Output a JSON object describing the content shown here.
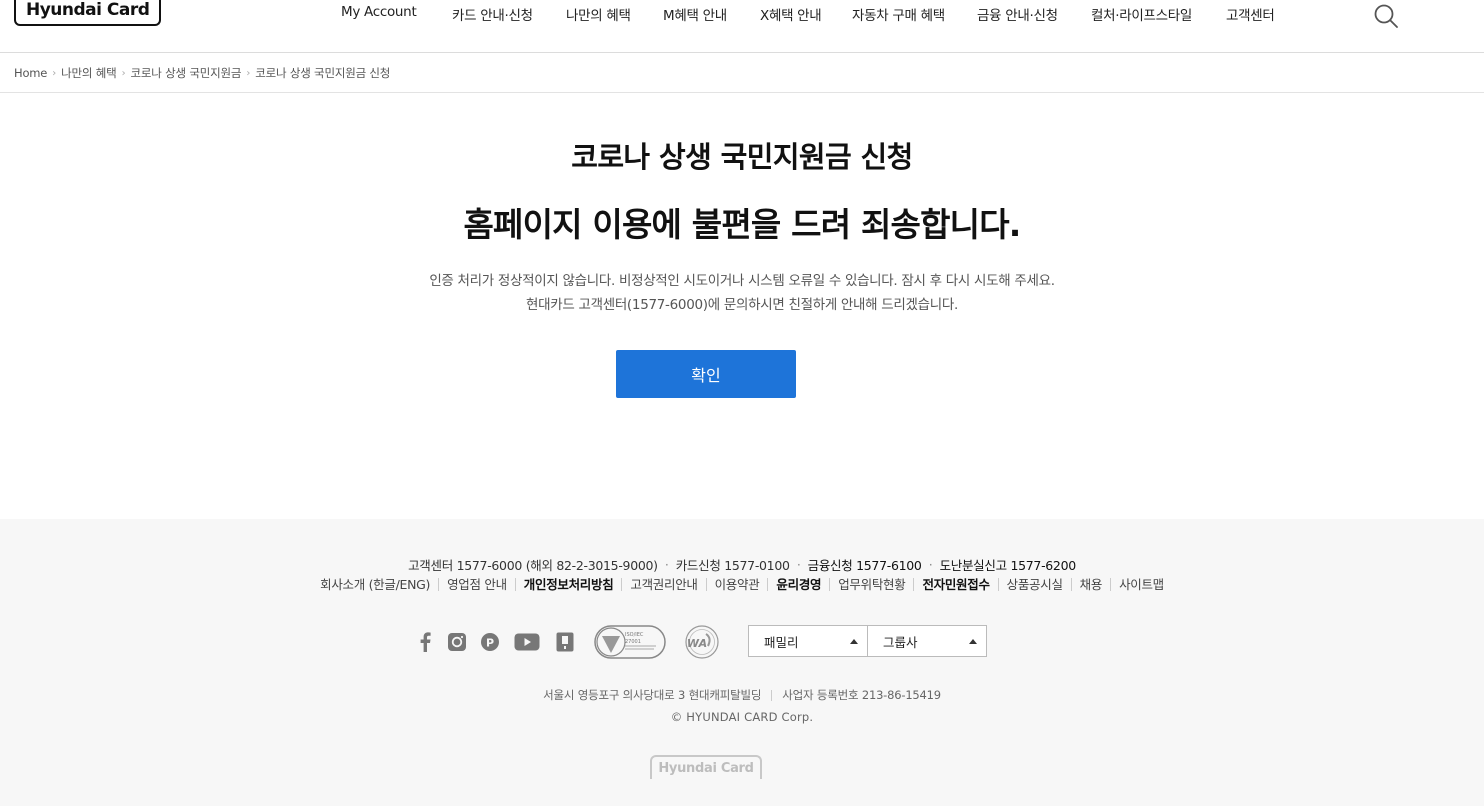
{
  "header": {
    "logo_text": "Hyundai Card",
    "nav": [
      {
        "label": "My Account"
      },
      {
        "label": "카드 안내·신청"
      },
      {
        "label": "나만의 혜택"
      },
      {
        "label": "M혜택 안내"
      },
      {
        "label": "X혜택 안내"
      },
      {
        "label": "자동차 구매 혜택"
      },
      {
        "label": "금융 안내·신청"
      },
      {
        "label": "컬처·라이프스타일"
      },
      {
        "label": "고객센터"
      }
    ],
    "search_icon": "search-icon"
  },
  "breadcrumb": [
    {
      "label": "Home"
    },
    {
      "label": "나만의 혜택"
    },
    {
      "label": "코로나 상생 국민지원금"
    },
    {
      "label": "코로나 상생 국민지원금 신청"
    }
  ],
  "main": {
    "page_title": "코로나 상생 국민지원금 신청",
    "error_title": "홈페이지 이용에 불편을 드려 죄송합니다.",
    "error_desc_line1": "인증 처리가 정상적이지 않습니다. 비정상적인 시도이거나 시스템 오류일 수 있습니다. 잠시 후 다시 시도해 주세요.",
    "error_desc_line2": "현대카드 고객센터(1577-6000)에 문의하시면 친절하게 안내해 드리겠습니다.",
    "confirm_label": "확인"
  },
  "footer": {
    "contacts": [
      {
        "text": "고객센터 1577-6000 (해외 82-2-3015-9000)"
      },
      {
        "text": "카드신청 1577-0100"
      },
      {
        "text": "금융신청 1577-6100"
      },
      {
        "text": "도난분실신고 1577-6200"
      }
    ],
    "links": [
      {
        "label": "회사소개 (한글/ENG)",
        "bold": false
      },
      {
        "label": "영업점 안내",
        "bold": false
      },
      {
        "label": "개인정보처리방침",
        "bold": true
      },
      {
        "label": "고객권리안내",
        "bold": false
      },
      {
        "label": "이용약관",
        "bold": false
      },
      {
        "label": "윤리경영",
        "bold": true
      },
      {
        "label": "업무위탁현황",
        "bold": false
      },
      {
        "label": "전자민원접수",
        "bold": true
      },
      {
        "label": "상품공시실",
        "bold": false
      },
      {
        "label": "채용",
        "bold": false
      },
      {
        "label": "사이트맵",
        "bold": false
      }
    ],
    "sns_icons": [
      "facebook-icon",
      "instagram-icon",
      "pay-icon",
      "youtube-icon",
      "app-icon"
    ],
    "family_select": "패밀리",
    "group_select": "그룹사",
    "address": "서울시 영등포구 의사당대로 3 현대캐피탈빌딩",
    "business_number": "사업자 등록번호  213-86-15419",
    "copyright": "© HYUNDAI CARD Corp.",
    "footer_logo_text": "Hyundai Card",
    "cert_texts": {
      "iso_top": "ISO/IEC",
      "iso_num": "27001",
      "wa": "WA"
    }
  }
}
